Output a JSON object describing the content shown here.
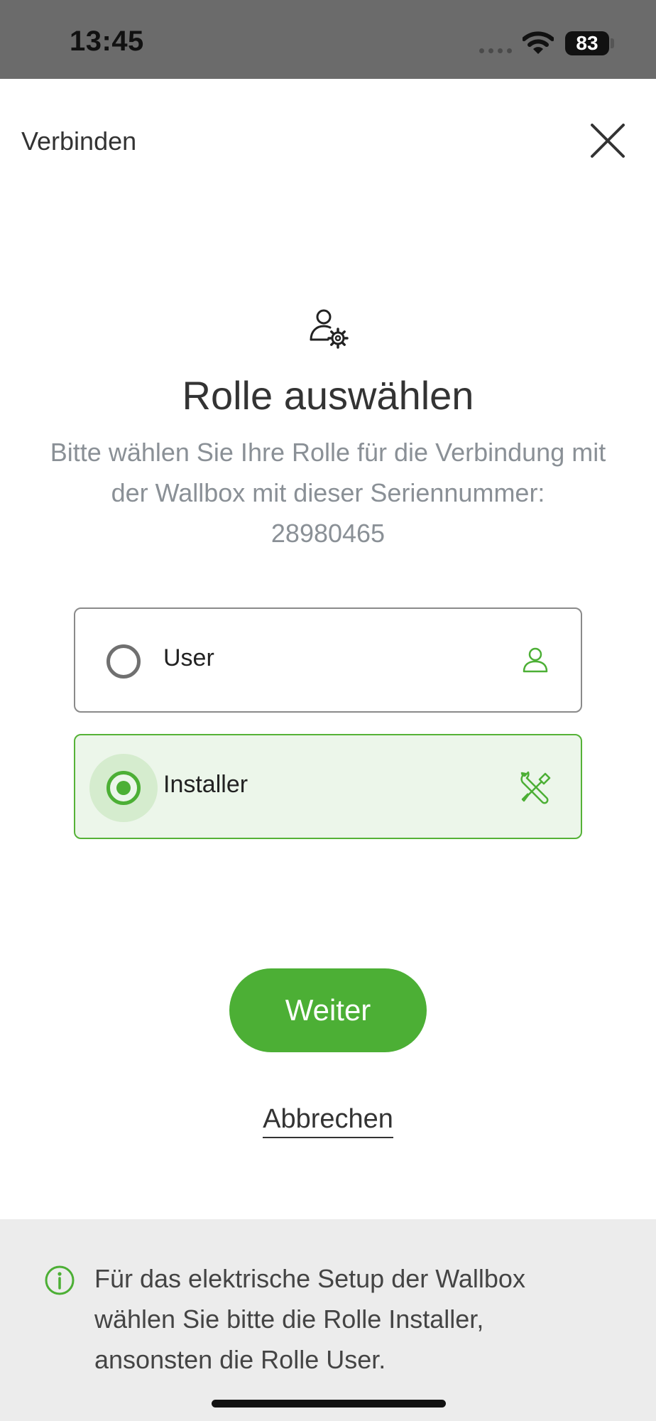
{
  "status_bar": {
    "time": "13:45",
    "battery": "83",
    "icons": [
      "signal-dots-icon",
      "wifi-icon",
      "battery-icon"
    ]
  },
  "header": {
    "title": "Verbinden",
    "close_icon": "close-icon"
  },
  "intro": {
    "icon": "user-settings-icon",
    "title": "Rolle auswählen",
    "description_lines": [
      "Bitte wählen Sie Ihre Rolle für die Verbindung mit",
      "der Wallbox mit dieser Seriennummer:",
      "28980465"
    ]
  },
  "role_options": [
    {
      "label": "User",
      "selected": false,
      "icon": "user-icon"
    },
    {
      "label": "Installer",
      "selected": true,
      "icon": "tools-icon"
    }
  ],
  "actions": {
    "primary_label": "Weiter",
    "secondary_label": "Abbrechen"
  },
  "info": {
    "icon": "info-icon",
    "text_lines": [
      "Für das elektrische Setup der Wallbox",
      "wählen Sie bitte die Rolle Installer,",
      "ansonsten die Rolle User."
    ]
  },
  "colors": {
    "accent": "#4caf35",
    "selected_bg": "#ecf6ea",
    "status_bar": "#6b6b6b",
    "muted_text": "#8a9096",
    "info_panel": "#ececec"
  }
}
